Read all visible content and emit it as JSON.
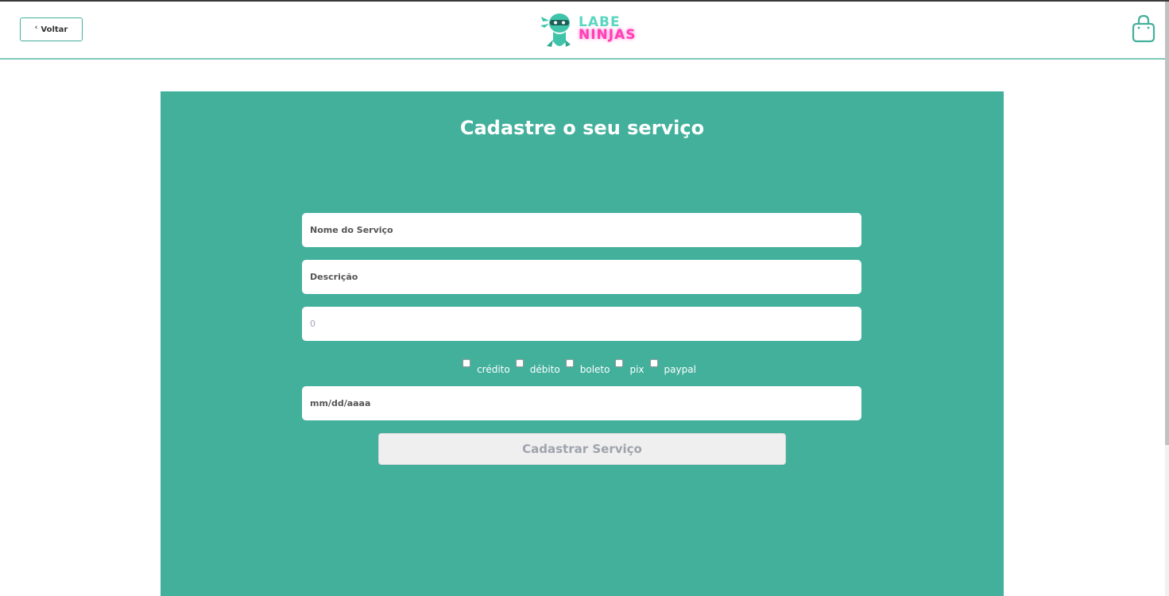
{
  "header": {
    "back_label": "Voltar",
    "back_chevron": "‹",
    "logo": {
      "line1": "LABE",
      "line2": "NINJAS",
      "accent_color": "#5ad6c0",
      "secondary_color": "#ff3fb4"
    },
    "cart_icon": "shopping-bag-icon"
  },
  "form": {
    "title": "Cadastre o seu serviço",
    "name_placeholder": "Nome do Serviço",
    "description_placeholder": "Descrição",
    "price_placeholder": "0",
    "date_placeholder": "mm/dd/aaaa",
    "payment_methods": [
      {
        "label": "crédito",
        "checked": false
      },
      {
        "label": "débito",
        "checked": false
      },
      {
        "label": "boleto",
        "checked": false
      },
      {
        "label": "pix",
        "checked": false
      },
      {
        "label": "paypal",
        "checked": false
      }
    ],
    "submit_label": "Cadastrar Serviço"
  },
  "colors": {
    "panel": "#43b09c",
    "border": "#7fc9b9",
    "button_disabled": "#efefef"
  }
}
